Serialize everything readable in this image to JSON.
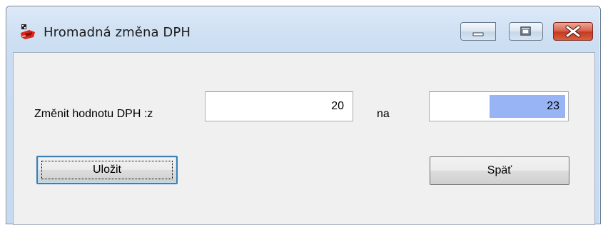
{
  "window": {
    "title": "Hromadná změna DPH",
    "app_icon": "app-logo-icon",
    "controls": {
      "minimize_icon": "minimize-icon",
      "maximize_icon": "maximize-icon",
      "close_icon": "close-icon"
    }
  },
  "form": {
    "change_label": "Změnit hodnotu DPH :z",
    "from_value": "20",
    "to_label": "na",
    "to_value": "23"
  },
  "buttons": {
    "save_label": "Uložit",
    "back_label": "Späť"
  },
  "colors": {
    "selection": "#99b4f5",
    "close_button": "#c53a22",
    "focus_border": "#3c7fb1"
  }
}
